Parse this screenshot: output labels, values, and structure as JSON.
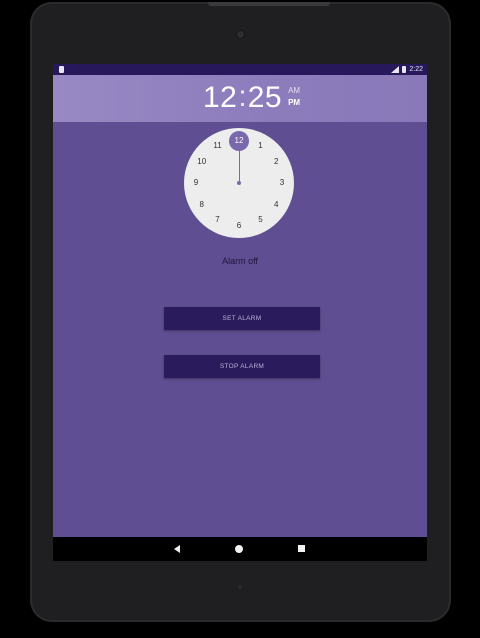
{
  "status_bar": {
    "time": "2:22",
    "left_icon": "sd-card-icon",
    "signal_icon": "signal-icon",
    "battery_icon": "battery-icon"
  },
  "time_display": {
    "hour": "12",
    "separator": ":",
    "minute": "25",
    "am_label": "AM",
    "pm_label": "PM",
    "selected_period": "PM"
  },
  "clock": {
    "selected_hour": "12",
    "numbers": [
      "1",
      "2",
      "3",
      "4",
      "5",
      "6",
      "7",
      "8",
      "9",
      "10",
      "11"
    ],
    "face_color": "#ededed",
    "accent_color": "#7a68ad"
  },
  "alarm": {
    "status_text": "Alarm off",
    "set_label": "SET ALARM",
    "stop_label": "STOP ALARM"
  },
  "navigation": {
    "back_icon": "back-icon",
    "home_icon": "home-icon",
    "recents_icon": "recents-icon"
  },
  "colors": {
    "background": "#5f4e91",
    "header": "#8c7cbc",
    "status_bar": "#26185a",
    "button": "#2a1b5c"
  }
}
